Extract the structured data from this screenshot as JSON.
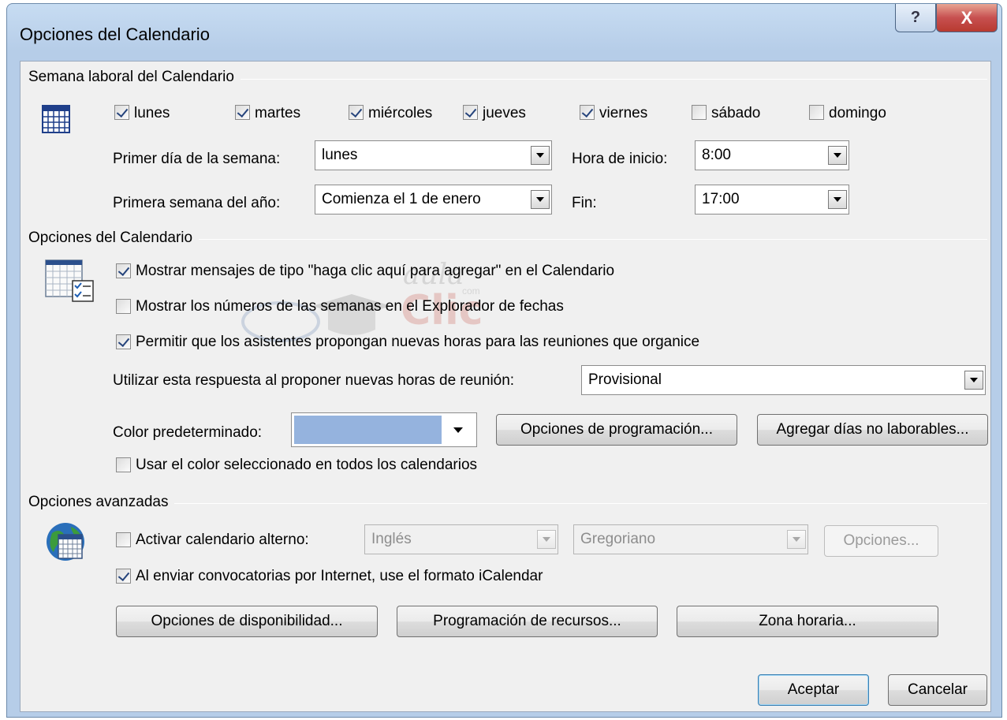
{
  "window": {
    "title": "Opciones del Calendario",
    "help_glyph": "?",
    "close_glyph": "X"
  },
  "work_week": {
    "section_label": "Semana laboral del Calendario",
    "days": [
      {
        "label": "lunes",
        "checked": true
      },
      {
        "label": "martes",
        "checked": true
      },
      {
        "label": "miércoles",
        "checked": true
      },
      {
        "label": "jueves",
        "checked": true
      },
      {
        "label": "viernes",
        "checked": true
      },
      {
        "label": "sábado",
        "checked": false
      },
      {
        "label": "domingo",
        "checked": false
      }
    ],
    "first_day_label": "Primer día de la semana:",
    "first_day_value": "lunes",
    "start_time_label": "Hora de inicio:",
    "start_time_value": "8:00",
    "first_week_label": "Primera semana del año:",
    "first_week_value": "Comienza el 1 de enero",
    "end_time_label": "Fin:",
    "end_time_value": "17:00"
  },
  "calendar_options": {
    "section_label": "Opciones del Calendario",
    "show_click_to_add": {
      "label": "Mostrar mensajes de tipo \"haga clic aquí para agregar\" en el Calendario",
      "checked": true
    },
    "show_week_numbers": {
      "label": "Mostrar los números de las semanas en el Explorador de fechas",
      "checked": false
    },
    "allow_propose": {
      "label": "Permitir que los asistentes propongan nuevas horas para las reuniones que organice",
      "checked": true
    },
    "response_label": "Utilizar esta respuesta al proponer nuevas horas de reunión:",
    "response_value": "Provisional",
    "default_color_label": "Color predeterminado:",
    "default_color": "#95b3de",
    "scheduling_button": "Opciones de programación...",
    "add_holidays_button": "Agregar días no laborables...",
    "use_color_all": {
      "label": "Usar el color seleccionado en todos los calendarios",
      "checked": false
    }
  },
  "advanced": {
    "section_label": "Opciones avanzadas",
    "alt_calendar": {
      "label": "Activar calendario alterno:",
      "checked": false
    },
    "alt_language_value": "Inglés",
    "alt_type_value": "Gregoriano",
    "alt_options_button": "Opciones...",
    "icalendar": {
      "label": "Al enviar convocatorias por Internet, use el formato iCalendar",
      "checked": true
    },
    "free_busy_button": "Opciones de disponibilidad...",
    "resource_button": "Programación de recursos...",
    "timezone_button": "Zona horaria..."
  },
  "footer": {
    "ok_button": "Aceptar",
    "cancel_button": "Cancelar"
  },
  "watermark": {
    "text_top": "aula",
    "text_main": "Clic",
    "text_small": "com"
  }
}
